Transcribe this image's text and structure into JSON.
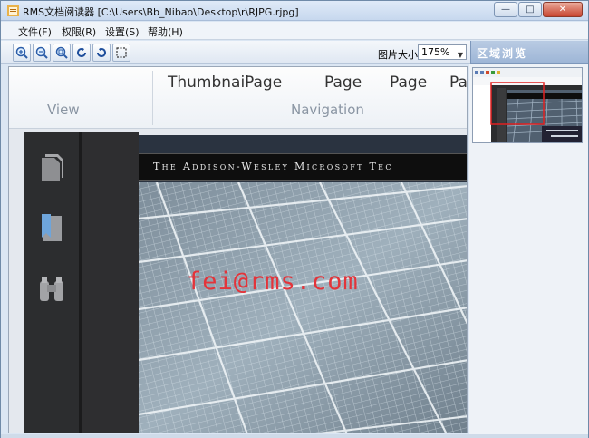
{
  "window": {
    "title": "RMS文档阅读器 [C:\\Users\\Bb_Nibao\\Desktop\\r\\RJPG.rjpg]",
    "minimize_glyph": "—",
    "maximize_glyph": "□",
    "close_glyph": "✕"
  },
  "menu": {
    "items": [
      {
        "label": "文件(F)"
      },
      {
        "label": "权限(R)"
      },
      {
        "label": "设置(S)"
      },
      {
        "label": "帮助(H)"
      }
    ]
  },
  "toolbar": {
    "buttons": [
      {
        "icon": "zoom-in-icon"
      },
      {
        "icon": "zoom-out-icon"
      },
      {
        "icon": "actual-size-icon"
      },
      {
        "icon": "rotate-left-icon"
      },
      {
        "icon": "rotate-right-icon"
      },
      {
        "icon": "fit-window-icon"
      }
    ],
    "zoom_label": "图片大小",
    "zoom_value": "175%"
  },
  "region_panel": {
    "title": "区域浏览"
  },
  "document": {
    "ribbon": {
      "items": [
        "Thumbnail",
        "Page",
        "Page",
        "Page",
        "Pa"
      ],
      "groups": [
        "View",
        "Navigation"
      ]
    },
    "side_icons": [
      "pages-icon",
      "bookmark-icon",
      "binoculars-icon"
    ],
    "banner_text": "The Addison-Wesley Microsoft Tec",
    "watermark": "fei@rms.com"
  },
  "colors": {
    "accent": "#9db5d6",
    "watermark": "#e3343a",
    "dark_panel": "#2c2d2f"
  }
}
